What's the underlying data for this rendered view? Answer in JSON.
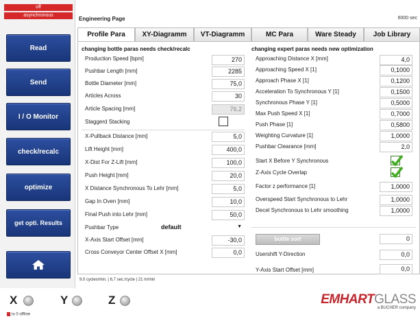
{
  "sidebar": {
    "status_top": "off",
    "status_mode": "asynchronous",
    "buttons": [
      "Read",
      "Send",
      "I / O Monitor",
      "check/recalc",
      "optimize",
      "get opti. Results"
    ]
  },
  "header": {
    "title": "Engineering Page",
    "right_text": "6000 sec"
  },
  "tabs": [
    "Profile Para",
    "XY-Diagramm",
    "VT-Diagramm",
    "MC Para",
    "Ware Steady",
    "Job Library"
  ],
  "left": {
    "heading": "changing bottle paras needs check/recalc",
    "rows": [
      {
        "label": "Production Speed [bpm]",
        "value": "270"
      },
      {
        "label": "Pushbar Length [mm]",
        "value": "2285"
      },
      {
        "label": "Bottle Diameter [mm]",
        "value": "75,0"
      },
      {
        "label": "Articles Across",
        "value": "30"
      },
      {
        "label": "Article Spacing [mm]",
        "value": "76,2"
      },
      {
        "label": "Staggerd Stacking",
        "value": ""
      },
      {
        "label": "X-Pullback Distance [mm]",
        "value": "5,0"
      },
      {
        "label": "Lift Height [mm]",
        "value": "400,0"
      },
      {
        "label": "X-Dist For Z-Lift [mm]",
        "value": "100,0"
      },
      {
        "label": "Push Height [mm]",
        "value": "20,0"
      },
      {
        "label": "X Distance Synchronous To Lehr [mm]",
        "value": "5,0"
      },
      {
        "label": "Gap In Oven [mm]",
        "value": "10,0"
      },
      {
        "label": "Final Push into Lehr [mm]",
        "value": "50,0"
      },
      {
        "label": "Pushbar Type",
        "value": "default"
      },
      {
        "label": "X-Axis Start Offset [mm]",
        "value": "-30,0"
      },
      {
        "label": "Cross Conveyor Center Offset X [mm]",
        "value": "0,0"
      }
    ]
  },
  "right": {
    "heading": "changing expert paras needs new optimization",
    "rows": [
      {
        "label": "Approaching Distance X [mm]",
        "value": "4,0"
      },
      {
        "label": "Approaching Speed X [1]",
        "value": "0,1000"
      },
      {
        "label": "Approach Phase X [1]",
        "value": "0,1200"
      },
      {
        "label": "Acceleration To Synchronous Y [1]",
        "value": "0,1500"
      },
      {
        "label": "Synchronous Phase Y [1]",
        "value": "0,5000"
      },
      {
        "label": "Max Push Speed X [1]",
        "value": "0,7000"
      },
      {
        "label": "Push Phase [1]",
        "value": "0,5800"
      },
      {
        "label": "Weighting Curvature [1]",
        "value": "1,0000"
      },
      {
        "label": "Pushbar Clearance [mm]",
        "value": "2,0"
      },
      {
        "label": "Start X Before Y Synchronous",
        "value": ""
      },
      {
        "label": "Z-Axis Cycle Overlap",
        "value": ""
      },
      {
        "label": "Factor z performance [1]",
        "value": "1,0000"
      },
      {
        "label": "Overspeed Start Synchronous to Lehr",
        "value": "1,0000"
      },
      {
        "label": "Decel Synchronous to Lehr smoothing",
        "value": "1,0000"
      }
    ],
    "bottle_sort_label": "bottle sort",
    "bottle_sort_value": "0",
    "usershift_label": "Usershift Y-Direction",
    "usershift_value": "0,0",
    "yaxis_label": "Y-Axis Start Offset [mm]",
    "yaxis_value": "0,0"
  },
  "status_line": "9,0 cycles/min. | 6,7 sec./cycle | 21 m/min",
  "axes": [
    "X",
    "Y",
    "Z"
  ],
  "io_status": "io 0 offline",
  "logo": {
    "brand_a": "EMHART",
    "brand_b": "GLASS",
    "sub": "a BUCHER company"
  },
  "colors": {
    "button_blue": "#1f3f8c",
    "status_red": "#d62828",
    "check_green": "#3fae1f",
    "logo_red": "#c6252b"
  }
}
